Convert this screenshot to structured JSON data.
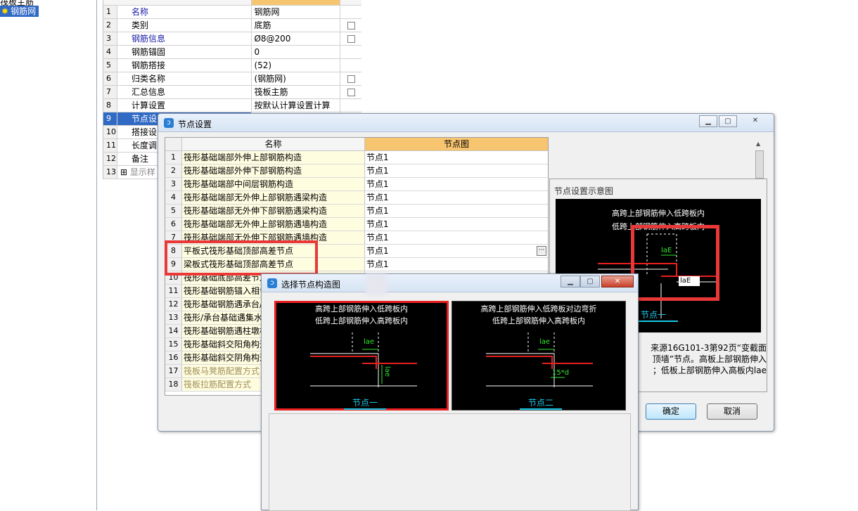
{
  "tree": {
    "partial_label": "筏板主筋",
    "selected_item": "钢筋网",
    "item_icon": "gear-sun-icon"
  },
  "props": {
    "rows": [
      {
        "num": "1",
        "name": "名称",
        "value": "钢筋网",
        "blue": true,
        "check": false
      },
      {
        "num": "2",
        "name": "类别",
        "value": "底筋",
        "blue": false,
        "check": true
      },
      {
        "num": "3",
        "name": "钢筋信息",
        "value": "Ø8@200",
        "blue": true,
        "check": true
      },
      {
        "num": "4",
        "name": "钢筋锚固",
        "value": "0",
        "blue": false,
        "check": false
      },
      {
        "num": "5",
        "name": "钢筋搭接",
        "value": "(52)",
        "blue": false,
        "check": false
      },
      {
        "num": "6",
        "name": "归类名称",
        "value": "(钢筋网)",
        "blue": false,
        "check": true
      },
      {
        "num": "7",
        "name": "汇总信息",
        "value": "筏板主筋",
        "blue": false,
        "check": true
      },
      {
        "num": "8",
        "name": "计算设置",
        "value": "按默认计算设置计算",
        "blue": false,
        "check": false
      },
      {
        "num": "9",
        "name": "节点设",
        "value": "",
        "blue": false,
        "check": false,
        "sel": true
      },
      {
        "num": "10",
        "name": "搭接设",
        "value": "",
        "blue": false,
        "check": false
      },
      {
        "num": "11",
        "name": "长度调",
        "value": "",
        "blue": false,
        "check": false
      },
      {
        "num": "12",
        "name": "备注",
        "value": "",
        "blue": false,
        "check": false
      },
      {
        "num": "13",
        "name": "显示样",
        "value": "",
        "blue": false,
        "check": false,
        "expand": true
      }
    ]
  },
  "node_dialog": {
    "title": "节点设置",
    "col_name": "名称",
    "col_node": "节点图",
    "rows": [
      {
        "num": "1",
        "name": "筏形基础端部外伸上部钢筋构造",
        "node": "节点1"
      },
      {
        "num": "2",
        "name": "筏形基础端部外伸下部钢筋构造",
        "node": "节点1"
      },
      {
        "num": "3",
        "name": "筏形基础端部中间层钢筋构造",
        "node": "节点1"
      },
      {
        "num": "4",
        "name": "筏形基础端部无外伸上部钢筋遇梁构造",
        "node": "节点1"
      },
      {
        "num": "5",
        "name": "筏形基础端部无外伸下部钢筋遇梁构造",
        "node": "节点1"
      },
      {
        "num": "6",
        "name": "筏形基础端部无外伸上部钢筋遇墙构造",
        "node": "节点1"
      },
      {
        "num": "7",
        "name": "筏形基础端部无外伸下部钢筋遇墙构造",
        "node": "节点1"
      },
      {
        "num": "8",
        "name": "平板式筏形基础顶部高差节点",
        "node": "节点1",
        "ellipsis": true
      },
      {
        "num": "9",
        "name": "梁板式筏形基础顶部高差节点",
        "node": "节点1"
      },
      {
        "num": "10",
        "name": "筏形基础底部高差节点",
        "node": ""
      },
      {
        "num": "11",
        "name": "筏形基础钢筋锚入相邻",
        "node": ""
      },
      {
        "num": "12",
        "name": "筏形基础钢筋遇承台/",
        "node": ""
      },
      {
        "num": "13",
        "name": "筏形/承台基础遇集水",
        "node": ""
      },
      {
        "num": "14",
        "name": "筏形基础钢筋遇柱墩构",
        "node": ""
      },
      {
        "num": "15",
        "name": "筏形基础斜交阳角构造",
        "node": ""
      },
      {
        "num": "16",
        "name": "筏形基础斜交阴角构造",
        "node": ""
      },
      {
        "num": "17",
        "name": "筏板马凳筋配置方式",
        "node": "",
        "gray": true
      },
      {
        "num": "18",
        "name": "筏板拉筋配置方式",
        "node": "",
        "gray": true
      }
    ],
    "preview_title": "节点设置示意图",
    "preview_line1": "高跨上部钢筋伸入低跨板内",
    "preview_line2": "低跨上部钢筋伸入高跨板内",
    "preview_node_label": "节点一",
    "preview_lae": "laE",
    "preview_desc": "来源16G101-3第92页“变截面\n顶墙”节点。高板上部钢筋伸入\n；低板上部钢筋伸入高板内lae",
    "ok_label": "确定",
    "cancel_label": "取消"
  },
  "select_dialog": {
    "title": "选择节点构造图",
    "options": [
      {
        "line1": "高跨上部钢筋伸入低跨板内",
        "line2": "低跨上部钢筋伸入高跨板内",
        "dim": "lae",
        "dim2": "lae",
        "label": "节点一"
      },
      {
        "line1": "高跨上部钢筋伸入低跨板对边弯折",
        "line2": "低跨上部钢筋伸入高跨板内",
        "dim": "lae",
        "dim2": "15*d",
        "label": "节点二"
      }
    ]
  },
  "colors": {
    "accent_red": "#e83838",
    "cad_cyan": "#19c8e8",
    "cad_green": "#30e830",
    "selection_blue": "#316ac5",
    "header_orange": "#f7c470"
  }
}
